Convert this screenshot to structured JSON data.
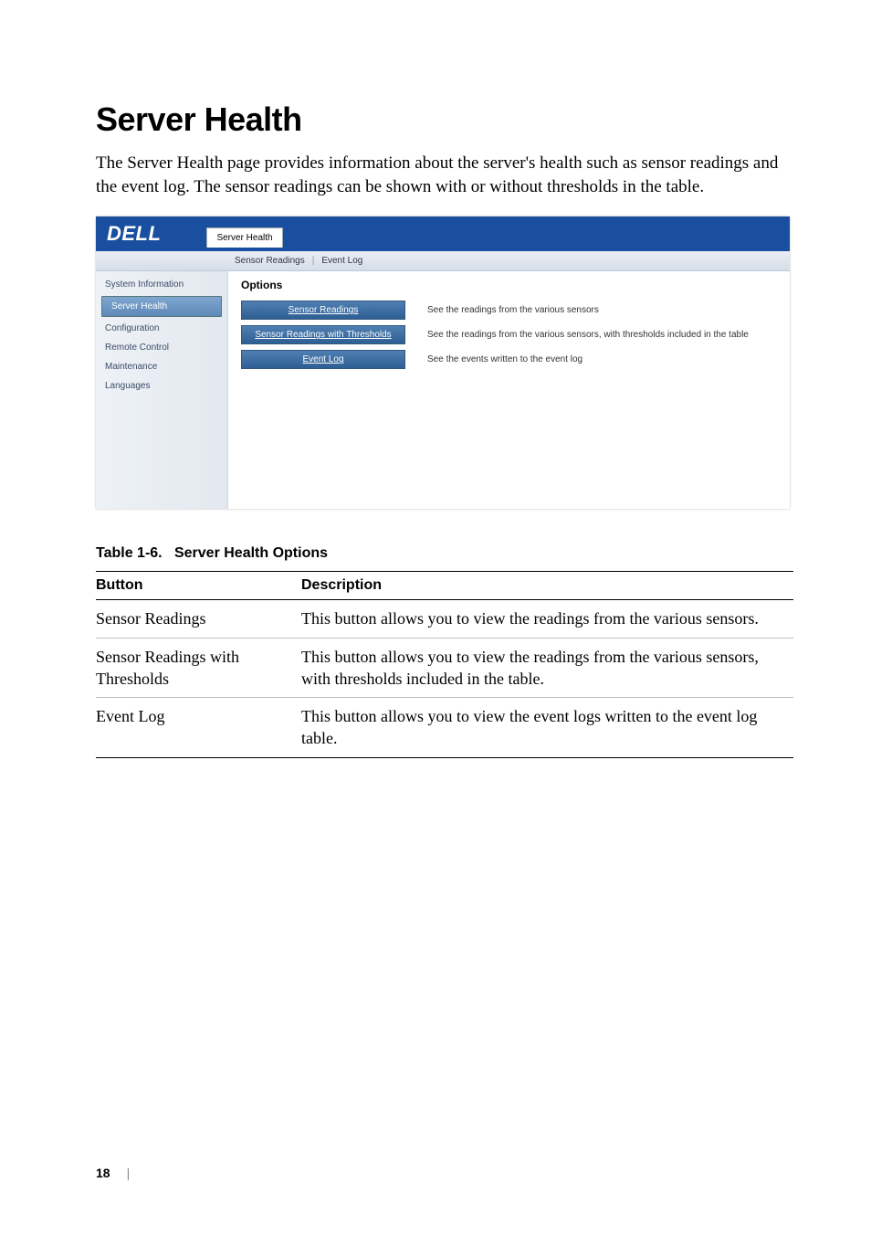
{
  "heading": "Server Health",
  "lead": "The Server Health page provides information about the server's health such as sensor readings and the event log. The sensor readings can be shown with or without thresholds in the table.",
  "screenshot": {
    "logo": "DELL",
    "top_tab": "Server Health",
    "subnav": {
      "a": "Sensor Readings",
      "b": "Event Log"
    },
    "sidebar": {
      "items": [
        "System Information",
        "Server Health",
        "Configuration",
        "Remote Control",
        "Maintenance",
        "Languages"
      ]
    },
    "content_title": "Options",
    "rows": [
      {
        "btn": "Sensor Readings",
        "desc": "See the readings from the various sensors"
      },
      {
        "btn": "Sensor Readings with Thresholds",
        "desc": "See the readings from the various sensors, with thresholds included in the table"
      },
      {
        "btn": "Event Log",
        "desc": "See the events written to the event log"
      }
    ]
  },
  "table_caption_prefix": "Table 1-6.",
  "table_caption": "Server Health Options",
  "table": {
    "headers": [
      "Button",
      "Description"
    ],
    "rows": [
      {
        "c1": "Sensor Readings",
        "c2": "This button allows you to view the readings from the various sensors."
      },
      {
        "c1": "Sensor Readings with Thresholds",
        "c2": "This button allows you to view the readings from the various sensors, with thresholds included in the table."
      },
      {
        "c1": "Event Log",
        "c2": "This button allows you to view the event logs written to the event log table."
      }
    ]
  },
  "page_number": "18"
}
